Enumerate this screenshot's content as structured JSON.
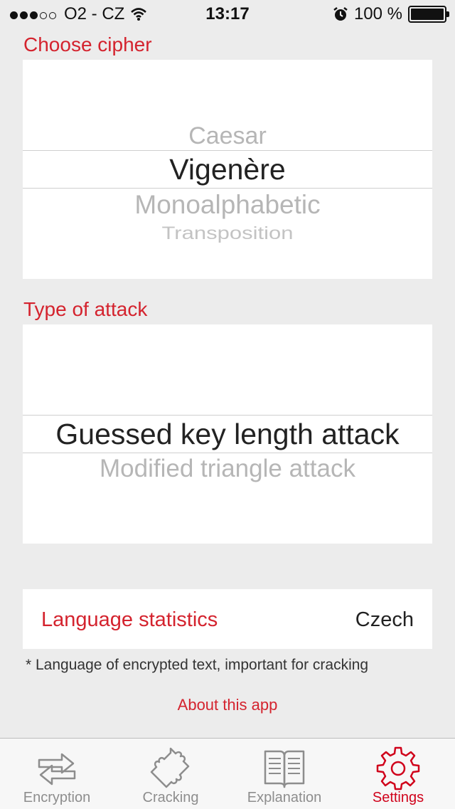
{
  "status_bar": {
    "carrier": "O2 - CZ",
    "time": "13:17",
    "battery": "100 %",
    "signal_icon": "signal-dots-icon",
    "wifi_icon": "wifi-icon",
    "alarm_icon": "alarm-icon",
    "battery_icon": "battery-icon"
  },
  "cipher_section": {
    "title": "Choose cipher",
    "options": [
      "Caesar",
      "Vigenère",
      "Monoalphabetic",
      "Transposition"
    ],
    "selected": "Vigenère"
  },
  "attack_section": {
    "title": "Type of attack",
    "options": [
      "Guessed key length attack",
      "Modified triangle attack"
    ],
    "selected": "Guessed key length attack"
  },
  "language": {
    "label": "Language statistics",
    "value": "Czech",
    "note": "* Language of encrypted text, important for cracking"
  },
  "about_link": "About this app",
  "tabs": [
    {
      "label": "Encryption",
      "icon": "arrows-icon"
    },
    {
      "label": "Cracking",
      "icon": "puzzle-icon"
    },
    {
      "label": "Explanation",
      "icon": "book-icon"
    },
    {
      "label": "Settings",
      "icon": "gear-icon",
      "active": true
    }
  ],
  "colors": {
    "accent": "#d4232e",
    "background": "#ececec",
    "tab_inactive": "#8d8d8d"
  }
}
